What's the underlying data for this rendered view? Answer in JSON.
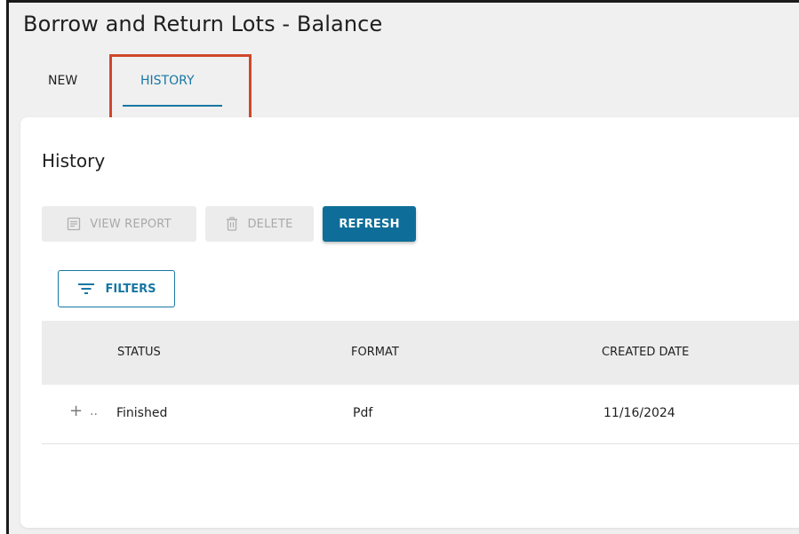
{
  "page": {
    "title": "Borrow and Return Lots - Balance"
  },
  "tabs": [
    {
      "label": "NEW",
      "active": false
    },
    {
      "label": "HISTORY",
      "active": true
    }
  ],
  "colors": {
    "accent": "#1777a3",
    "primary_button": "#0f6e99",
    "highlight_box": "#d0472a",
    "disabled_text": "#a9a9a9"
  },
  "history": {
    "title": "History",
    "toolbar": {
      "view_report_label": "VIEW REPORT",
      "delete_label": "DELETE",
      "refresh_label": "REFRESH"
    },
    "filters_label": "FILTERS",
    "table": {
      "headers": {
        "status": "STATUS",
        "format": "FORMAT",
        "created": "CREATED DATE"
      },
      "rows": [
        {
          "expand": "+",
          "menu": "..",
          "status": "Finished",
          "format": "Pdf",
          "created": "11/16/2024"
        }
      ]
    }
  },
  "icons": {
    "view_report": "report-icon",
    "delete": "trash-icon",
    "filters": "filter-icon",
    "expand": "plus-icon"
  }
}
